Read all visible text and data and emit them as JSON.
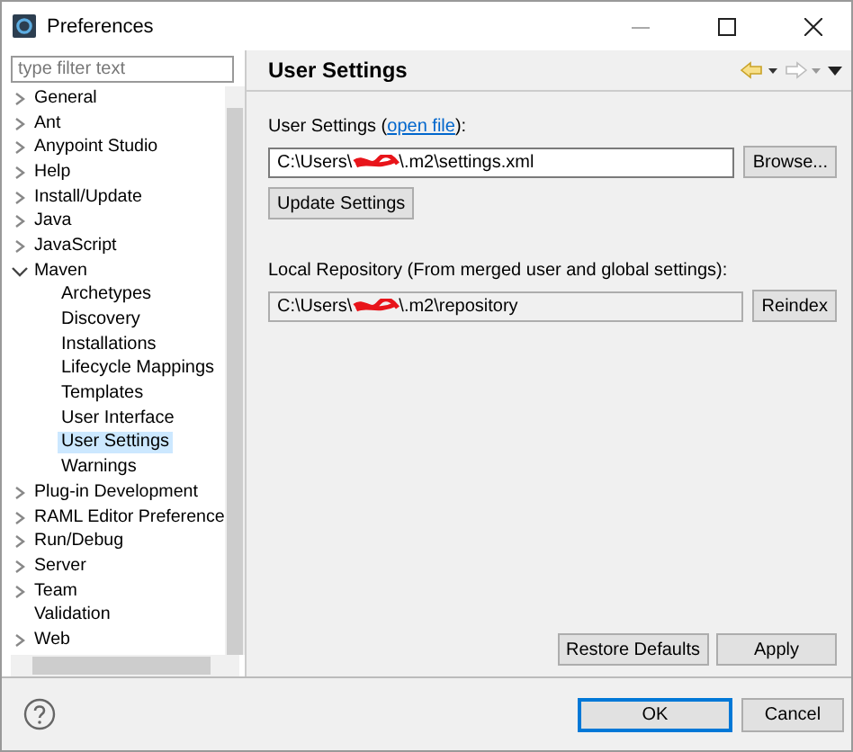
{
  "window": {
    "title": "Preferences"
  },
  "filter": {
    "placeholder": "type filter text"
  },
  "tree": [
    {
      "label": "General",
      "kind": "folder",
      "expanded": false,
      "selected": false
    },
    {
      "label": "Ant",
      "kind": "folder",
      "expanded": false,
      "selected": false
    },
    {
      "label": "Anypoint Studio",
      "kind": "folder",
      "expanded": false,
      "selected": false
    },
    {
      "label": "Help",
      "kind": "folder",
      "expanded": false,
      "selected": false
    },
    {
      "label": "Install/Update",
      "kind": "folder",
      "expanded": false,
      "selected": false
    },
    {
      "label": "Java",
      "kind": "folder",
      "expanded": false,
      "selected": false
    },
    {
      "label": "JavaScript",
      "kind": "folder",
      "expanded": false,
      "selected": false
    },
    {
      "label": "Maven",
      "kind": "folder",
      "expanded": true,
      "selected": false,
      "children": [
        {
          "label": "Archetypes",
          "selected": false
        },
        {
          "label": "Discovery",
          "selected": false
        },
        {
          "label": "Installations",
          "selected": false
        },
        {
          "label": "Lifecycle Mappings",
          "selected": false
        },
        {
          "label": "Templates",
          "selected": false
        },
        {
          "label": "User Interface",
          "selected": false
        },
        {
          "label": "User Settings",
          "selected": true
        },
        {
          "label": "Warnings",
          "selected": false
        }
      ]
    },
    {
      "label": "Plug-in Development",
      "kind": "folder",
      "expanded": false,
      "selected": false
    },
    {
      "label": "RAML Editor Preference",
      "kind": "folder",
      "expanded": false,
      "selected": false
    },
    {
      "label": "Run/Debug",
      "kind": "folder",
      "expanded": false,
      "selected": false
    },
    {
      "label": "Server",
      "kind": "folder",
      "expanded": false,
      "selected": false
    },
    {
      "label": "Team",
      "kind": "folder",
      "expanded": false,
      "selected": false
    },
    {
      "label": "Validation",
      "kind": "leaf",
      "selected": false
    },
    {
      "label": "Web",
      "kind": "folder",
      "expanded": false,
      "selected": false
    }
  ],
  "page": {
    "title": "User Settings",
    "settings_label": "User Settings (",
    "settings_link": "open file",
    "settings_label_end": "):",
    "settings_path": {
      "before": "C:\\Users\\",
      "after": "\\.m2\\settings.xml"
    },
    "browse_button": "Browse...",
    "update_button": "Update Settings",
    "repository_label": "Local Repository (From merged user and global settings):",
    "repository_path": {
      "before": "C:\\Users\\",
      "after": "\\.m2\\repository"
    },
    "reindex_button": "Reindex",
    "restore_button": "Restore Defaults",
    "apply_button": "Apply"
  },
  "buttons": [
    {
      "label": "OK",
      "selected": true
    },
    {
      "label": "Cancel",
      "selected": false
    }
  ]
}
